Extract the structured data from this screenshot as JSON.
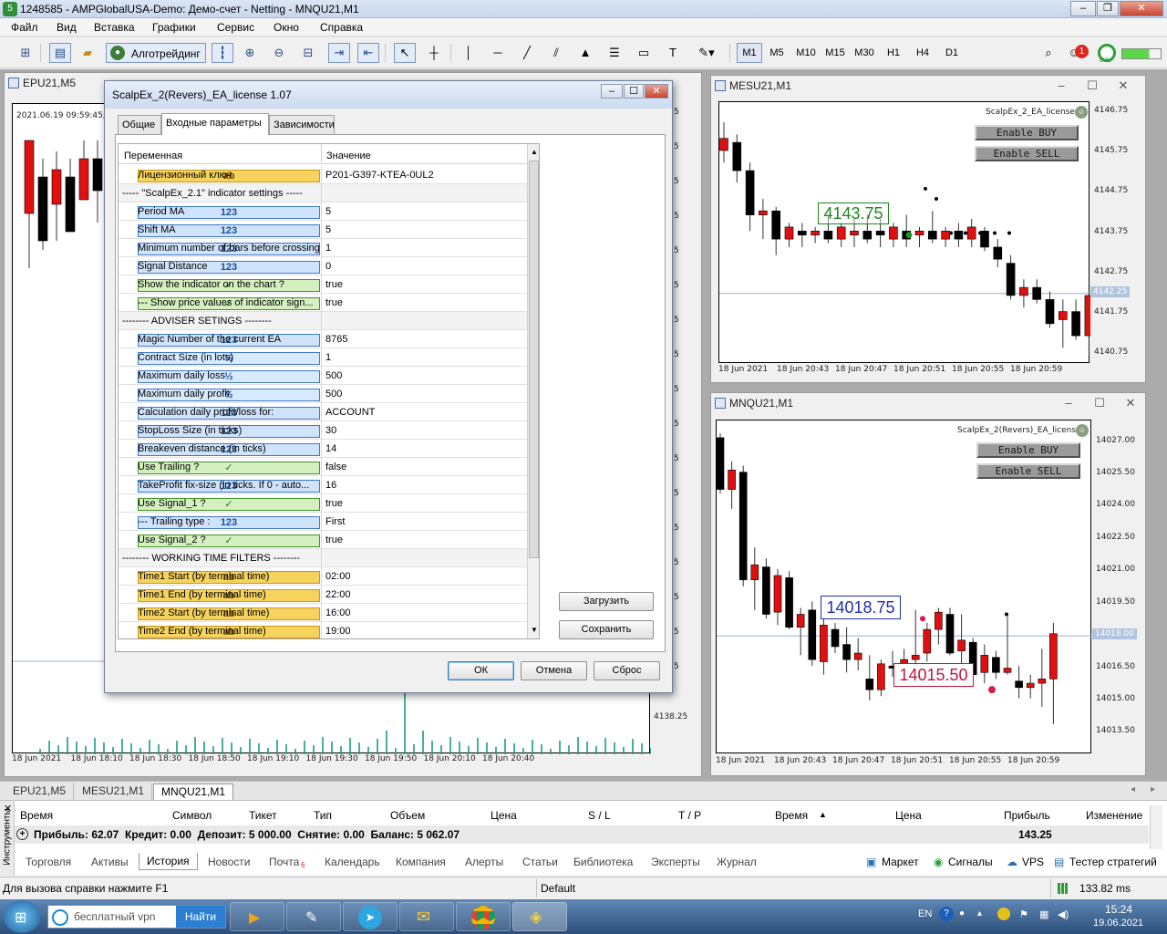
{
  "title": "1248585 - AMPGlobalUSA-Demo: Демо-счет - Netting - MNQU21,M1",
  "menu": [
    "Файл",
    "Вид",
    "Вставка",
    "Графики",
    "Сервис",
    "Окно",
    "Справка"
  ],
  "toolbar": {
    "algo_label": "Алготрейдинг",
    "timeframes": [
      "M1",
      "M5",
      "M10",
      "M15",
      "M30",
      "H1",
      "H4",
      "D1"
    ],
    "notif_count": "1",
    "lvl_label": "LVL"
  },
  "chart_epu": {
    "title": "EPU21,M5",
    "info": "2021.06.19 09:59:45; E",
    "price_label": "4138.25",
    "x_labels": [
      "18 Jun 2021",
      "18 Jun 18:10",
      "18 Jun 18:30",
      "18 Jun 18:50",
      "18 Jun 19:10",
      "18 Jun 19:30",
      "18 Jun 19:50",
      "18 Jun 20:10",
      "18 Jun 20:40"
    ],
    "right_stub": [
      "5",
      "5",
      "5",
      "5",
      "5",
      "5",
      "5",
      "5",
      "5",
      "5",
      "5",
      "5",
      "5",
      "5",
      "5",
      "5",
      "5"
    ]
  },
  "chart_mesu": {
    "title": "MESU21,M1",
    "ea_label": "ScalpEx_2_EA_license",
    "buy": "Enable BUY",
    "sell": "Enable SELL",
    "price_box": "4143.75",
    "y_labels": [
      "4146.75",
      "4145.75",
      "4144.75",
      "4143.75",
      "4142.75",
      "4141.75",
      "4140.75"
    ],
    "current_price": "4142.25",
    "x_labels": [
      "18 Jun 2021",
      "18 Jun 20:43",
      "18 Jun 20:47",
      "18 Jun 20:51",
      "18 Jun 20:55",
      "18 Jun 20:59"
    ],
    "chart_data": {
      "type": "candlestick",
      "y_range": [
        4140.5,
        4147
      ],
      "candles": [
        [
          4145.8,
          4146.5,
          4145.5,
          4146.1
        ],
        [
          4146.0,
          4146.2,
          4145.0,
          4145.3
        ],
        [
          4145.3,
          4145.5,
          4143.8,
          4144.2
        ],
        [
          4144.2,
          4144.6,
          4143.6,
          4144.3
        ],
        [
          4144.3,
          4144.4,
          4143.2,
          4143.6
        ],
        [
          4143.6,
          4144.0,
          4143.4,
          4143.9
        ],
        [
          4143.8,
          4144.0,
          4143.4,
          4143.7
        ],
        [
          4143.7,
          4143.9,
          4143.5,
          4143.8
        ],
        [
          4143.8,
          4144.2,
          4143.5,
          4143.6
        ],
        [
          4143.6,
          4144.0,
          4143.4,
          4143.9
        ],
        [
          4143.7,
          4144.1,
          4143.4,
          4143.8
        ],
        [
          4143.8,
          4144.2,
          4143.5,
          4143.6
        ],
        [
          4143.8,
          4144.1,
          4143.4,
          4143.7
        ],
        [
          4143.6,
          4144.0,
          4143.4,
          4143.9
        ],
        [
          4143.8,
          4144.2,
          4143.4,
          4143.6
        ],
        [
          4143.7,
          4143.9,
          4143.4,
          4143.8
        ],
        [
          4143.8,
          4144.3,
          4143.5,
          4143.6
        ],
        [
          4143.6,
          4143.9,
          4143.4,
          4143.8
        ],
        [
          4143.8,
          4144.0,
          4143.4,
          4143.6
        ],
        [
          4143.6,
          4144.1,
          4143.4,
          4143.9
        ],
        [
          4143.8,
          4143.9,
          4143.3,
          4143.4
        ],
        [
          4143.4,
          4143.6,
          4142.9,
          4143.1
        ],
        [
          4143.0,
          4143.2,
          4142.1,
          4142.2
        ],
        [
          4142.2,
          4142.6,
          4141.9,
          4142.4
        ],
        [
          4142.4,
          4142.6,
          4142.0,
          4142.1
        ],
        [
          4142.1,
          4142.3,
          4141.4,
          4141.5
        ],
        [
          4141.6,
          4142.1,
          4140.9,
          4141.8
        ],
        [
          4141.8,
          4142.1,
          4141.1,
          4141.2
        ],
        [
          4141.2,
          4142.3,
          4140.7,
          4142.2
        ]
      ]
    }
  },
  "chart_mnqu": {
    "title": "MNQU21,M1",
    "ea_label": "ScalpEx_2(Revers)_EA_license",
    "buy": "Enable BUY",
    "sell": "Enable SELL",
    "price_box_blue": "14018.75",
    "price_box_red": "14015.50",
    "y_labels": [
      "14027.00",
      "14025.50",
      "14024.00",
      "14022.50",
      "14021.00",
      "14019.50",
      "14018.00",
      "14016.50",
      "14015.00",
      "14013.50"
    ],
    "current_price": "14018.00",
    "x_labels": [
      "18 Jun 2021",
      "18 Jun 20:43",
      "18 Jun 20:47",
      "18 Jun 20:51",
      "18 Jun 20:55",
      "18 Jun 20:59"
    ],
    "chart_data": {
      "type": "candlestick",
      "y_range": [
        14012.5,
        14028
      ],
      "candles": [
        [
          14027.2,
          14027.4,
          14024.6,
          14024.8
        ],
        [
          14024.8,
          14026.1,
          14023.9,
          14025.7
        ],
        [
          14025.6,
          14025.9,
          14020.3,
          14020.6
        ],
        [
          14020.6,
          14022.1,
          14019.2,
          14021.3
        ],
        [
          14021.2,
          14021.6,
          14018.8,
          14019.0
        ],
        [
          14019.1,
          14021.1,
          14018.5,
          14020.8
        ],
        [
          14020.7,
          14021.0,
          14018.3,
          14018.4
        ],
        [
          14018.4,
          14019.3,
          14017.1,
          14019.0
        ],
        [
          14019.2,
          14019.6,
          14016.6,
          14016.9
        ],
        [
          14016.8,
          14018.8,
          14016.2,
          14018.5
        ],
        [
          14018.3,
          14018.6,
          14017.2,
          14017.5
        ],
        [
          14017.6,
          14018.4,
          14016.3,
          14016.9
        ],
        [
          14016.9,
          14017.9,
          14016.4,
          14017.2
        ],
        [
          14016.0,
          14017.1,
          14015.0,
          14015.5
        ],
        [
          14015.5,
          14016.9,
          14015.2,
          14016.7
        ],
        [
          14016.6,
          14017.3,
          14016.1,
          14016.5
        ],
        [
          14016.4,
          14017.4,
          14016.0,
          14016.9
        ],
        [
          14016.9,
          14019.2,
          14016.3,
          14017.1
        ],
        [
          14017.2,
          14018.6,
          14016.8,
          14018.3
        ],
        [
          14018.3,
          14019.3,
          14017.6,
          14019.1
        ],
        [
          14019.0,
          14019.3,
          14017.1,
          14017.2
        ],
        [
          14017.3,
          14019.0,
          14016.7,
          14017.8
        ],
        [
          14017.7,
          14017.9,
          14016.0,
          14016.2
        ],
        [
          14016.3,
          14017.6,
          14015.8,
          14017.1
        ],
        [
          14017.0,
          14017.3,
          14016.0,
          14016.3
        ],
        [
          14016.3,
          14018.9,
          14016.2,
          14016.5
        ],
        [
          14015.9,
          14016.6,
          14015.1,
          14015.6
        ],
        [
          14015.6,
          14016.2,
          14015.1,
          14015.8
        ],
        [
          14015.8,
          14017.4,
          14014.7,
          14016.0
        ],
        [
          14016.0,
          14018.6,
          14013.9,
          14018.1
        ]
      ]
    }
  },
  "dialog": {
    "title": "ScalpEx_2(Revers)_EA_license 1.07",
    "tabs": [
      "Общие",
      "Входные параметры",
      "Зависимости"
    ],
    "col_var": "Переменная",
    "col_val": "Значение",
    "rows": [
      {
        "icon": "ab",
        "name": "Лицензионный ключ",
        "value": "P201-G397-KTEA-0UL2"
      },
      {
        "icon": "",
        "name": "----- \"ScalpEx_2.1\" indicator settings -----",
        "value": ""
      },
      {
        "icon": "123",
        "name": "Period MA",
        "value": "5"
      },
      {
        "icon": "123",
        "name": "Shift MA",
        "value": "5"
      },
      {
        "icon": "123",
        "name": "Minimum number of bars before crossing",
        "value": "1"
      },
      {
        "icon": "123",
        "name": "Signal Distance",
        "value": "0"
      },
      {
        "icon": "bool",
        "name": "Show the indicator on the chart ?",
        "value": "true"
      },
      {
        "icon": "bool",
        "name": "--- Show price values of indicator sign...",
        "value": "true"
      },
      {
        "icon": "",
        "name": "--------  ADVISER SETINGS  --------",
        "value": ""
      },
      {
        "icon": "123",
        "name": "Magic Number of the current EA",
        "value": "8765"
      },
      {
        "icon": "1/2",
        "name": "Contract Size (in lots)",
        "value": "1"
      },
      {
        "icon": "1/2",
        "name": "Maximum daily loss",
        "value": "500"
      },
      {
        "icon": "1/2",
        "name": "Maximum daily profit",
        "value": "500"
      },
      {
        "icon": "123",
        "name": "Calculation daily profit/loss for:",
        "value": "ACCOUNT"
      },
      {
        "icon": "123",
        "name": "StopLoss Size (in ticks)",
        "value": "30"
      },
      {
        "icon": "123",
        "name": "Breakeven distance (in ticks)",
        "value": "14"
      },
      {
        "icon": "bool",
        "name": "Use Trailing ?",
        "value": "false"
      },
      {
        "icon": "123",
        "name": "TakeProfit fix-size (in ticks. If 0 - auto...",
        "value": "16"
      },
      {
        "icon": "bool",
        "name": "Use Signal_1 ?",
        "value": "true"
      },
      {
        "icon": "123",
        "name": "--- Trailing type :",
        "value": "First"
      },
      {
        "icon": "bool",
        "name": "Use Signal_2 ?",
        "value": "true"
      },
      {
        "icon": "",
        "name": "--------  WORKING TIME FILTERS  --------",
        "value": ""
      },
      {
        "icon": "ab",
        "name": "Time1 Start (by terminal time)",
        "value": "02:00"
      },
      {
        "icon": "ab",
        "name": "Time1 End (by terminal time)",
        "value": "22:00"
      },
      {
        "icon": "ab",
        "name": "Time2 Start (by terminal time)",
        "value": "16:00"
      },
      {
        "icon": "ab",
        "name": "Time2 End (by terminal time)",
        "value": "19:00"
      }
    ],
    "load": "Загрузить",
    "save": "Сохранить",
    "ok": "ОК",
    "cancel": "Отмена",
    "reset": "Сброс"
  },
  "window_tabs": [
    "EPU21,M5",
    "MESU21,M1",
    "MNQU21,M1"
  ],
  "toolbox": {
    "side_label": "Инструменты",
    "columns": [
      "Время",
      "Символ",
      "Тикет",
      "Тип",
      "Объем",
      "Цена",
      "S / L",
      "T / P",
      "Время",
      "Цена",
      "Прибыль",
      "Изменение"
    ],
    "summary": "Прибыль: 62.07  Кредит: 0.00  Депозит: 5 000.00  Снятие: 0.00  Баланс: 5 062.07",
    "summary_profit": "143.25",
    "tabs": [
      "Торговля",
      "Активы",
      "История",
      "Новости",
      "Почта",
      "Календарь",
      "Компания",
      "Алерты",
      "Статьи",
      "Библиотека",
      "Эксперты",
      "Журнал"
    ],
    "mail_count": "6",
    "right": [
      "Маркет",
      "Сигналы",
      "VPS",
      "Тестер стратегий"
    ]
  },
  "status": {
    "help": "Для вызова справки нажмите F1",
    "profile": "Default",
    "ping": "133.82 ms"
  },
  "taskbar": {
    "search_text": "бесплатный vpn",
    "search_btn": "Найти",
    "lang": "EN",
    "time": "15:24",
    "date": "19.06.2021"
  }
}
